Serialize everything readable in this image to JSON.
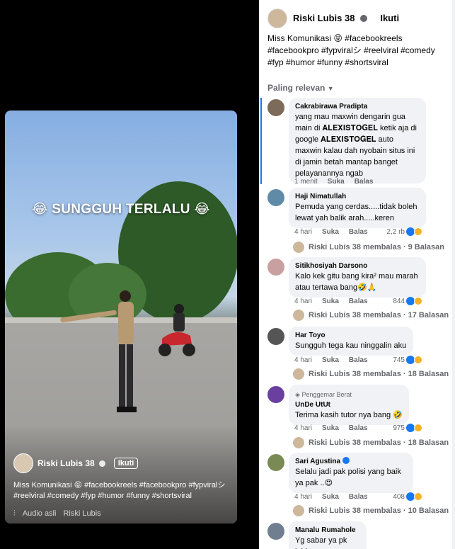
{
  "video": {
    "overlay_text": "😂 SUNGGUH TERLALU 😂",
    "author": "Riski Lubis 38",
    "follow": "Ikuti",
    "caption": "Miss Komunikasi 😝 #facebookreels #facebookpro #fypviralシ #reelviral #comedy #fyp #humor #funny #shortsviral",
    "audio": "Audio asli",
    "audio_author": "Riski Lubis"
  },
  "post": {
    "author": "Riski Lubis 38",
    "follow": "Ikuti",
    "caption": "Miss Komunikasi 😝 #facebookreels #facebookpro #fypviralシ #reelviral #comedy #fyp #humor #funny #shortsviral",
    "sort_label": "Paling relevan"
  },
  "comments": [
    {
      "name": "Cakrabirawa Pradipta",
      "text": "yang mau maxwin dengarin gua main di 𝐀𝐋𝐄𝐗𝐈𝐒𝐓𝐎𝐆𝐄𝐋 ketik aja di google 𝐀𝐋𝐄𝐗𝐈𝐒𝐓𝐎𝐆𝐄𝐋 auto maxwin kalau dah nyobain situs ini di jamin betah mantap banget pelayanannya ngab",
      "time": "1 menit",
      "like": "Suka",
      "reply": "Balas"
    },
    {
      "name": "Haji Nimatullah",
      "text": "Pemuda yang cerdas.....tidak boleh lewat yah balik arah.....keren",
      "time": "4 hari",
      "like": "Suka",
      "reply": "Balas",
      "reactions": "2,2 rb",
      "replies": "Riski Lubis 38 membalas · 9 Balasan"
    },
    {
      "name": "Sitikhosiyah Darsono",
      "text": "Kalo kek gitu bang kira² mau marah atau tertawa bang🤣🙏",
      "time": "4 hari",
      "like": "Suka",
      "reply": "Balas",
      "reactions": "844",
      "replies": "Riski Lubis 38 membalas · 17 Balasan"
    },
    {
      "name": "Har Toyo",
      "text": "Sungguh tega kau ninggalin aku",
      "time": "4 hari",
      "like": "Suka",
      "reply": "Balas",
      "reactions": "745",
      "replies": "Riski Lubis 38 membalas · 18 Balasan"
    },
    {
      "badge": "Penggemar Berat",
      "name": "UnDe UtUt",
      "text": "Terima kasih tutor nya bang 🤣",
      "time": "4 hari",
      "like": "Suka",
      "reply": "Balas",
      "reactions": "975",
      "replies": "Riski Lubis 38 membalas · 18 Balasan"
    },
    {
      "name": "Sari Agustina",
      "text": "Selalu jadi pak polisi yang baik ya pak ..😍",
      "time": "4 hari",
      "like": "Suka",
      "reply": "Balas",
      "reactions": "408",
      "replies": "Riski Lubis 38 membalas · 10 Balasan"
    },
    {
      "name": "Manalu Rumahole",
      "text": "Yg sabar ya pk lubis"
    }
  ]
}
